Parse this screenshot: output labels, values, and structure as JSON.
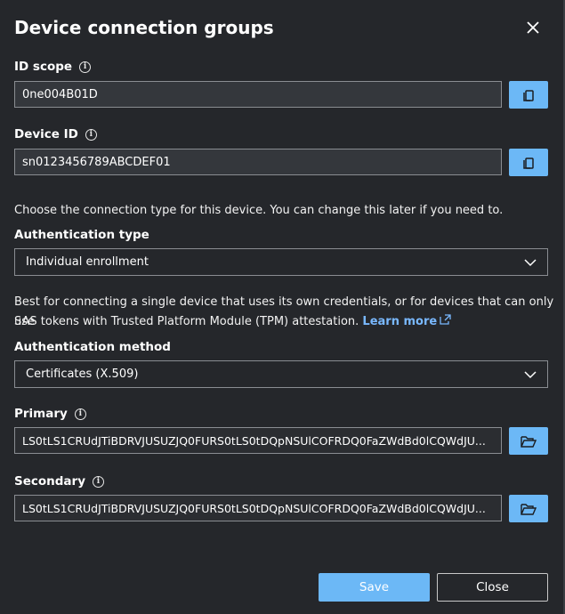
{
  "panel": {
    "title": "Device connection groups",
    "close_icon": "close-icon"
  },
  "id_scope": {
    "label": "ID scope",
    "value": "0ne004B01D",
    "copy_icon": "copy-icon"
  },
  "device_id": {
    "label": "Device ID",
    "value": "sn0123456789ABCDEF01",
    "copy_icon": "copy-icon"
  },
  "connection_type_text": "Choose the connection type for this device. You can change this later if you need to.",
  "authentication_type": {
    "label": "Authentication type",
    "selected": "Individual enrollment"
  },
  "description": {
    "line1": "Best for connecting a single device that uses its own credentials, or for devices that can only use",
    "line2": "SAS tokens with Trusted Platform Module (TPM) attestation.",
    "link": "Learn more"
  },
  "authentication_method": {
    "label": "Authentication method",
    "selected": "Certificates (X.509)"
  },
  "primary": {
    "label": "Primary",
    "value": "LS0tLS1CRUdJTiBDRVJUSUZJQ0FURS0tLS0tDQpNSUlCOFRDQ0FaZWdBd0lCQWdJU..."
  },
  "secondary": {
    "label": "Secondary",
    "value": "LS0tLS1CRUdJTiBDRVJUSUZJQ0FURS0tLS0tDQpNSUlCOFRDQ0FaZWdBd0lCQWdJU..."
  },
  "buttons": {
    "save": "Save",
    "close": "Close"
  },
  "colors": {
    "background": "#25272b",
    "accent": "#6cb8f6",
    "link": "#79b8ff"
  }
}
